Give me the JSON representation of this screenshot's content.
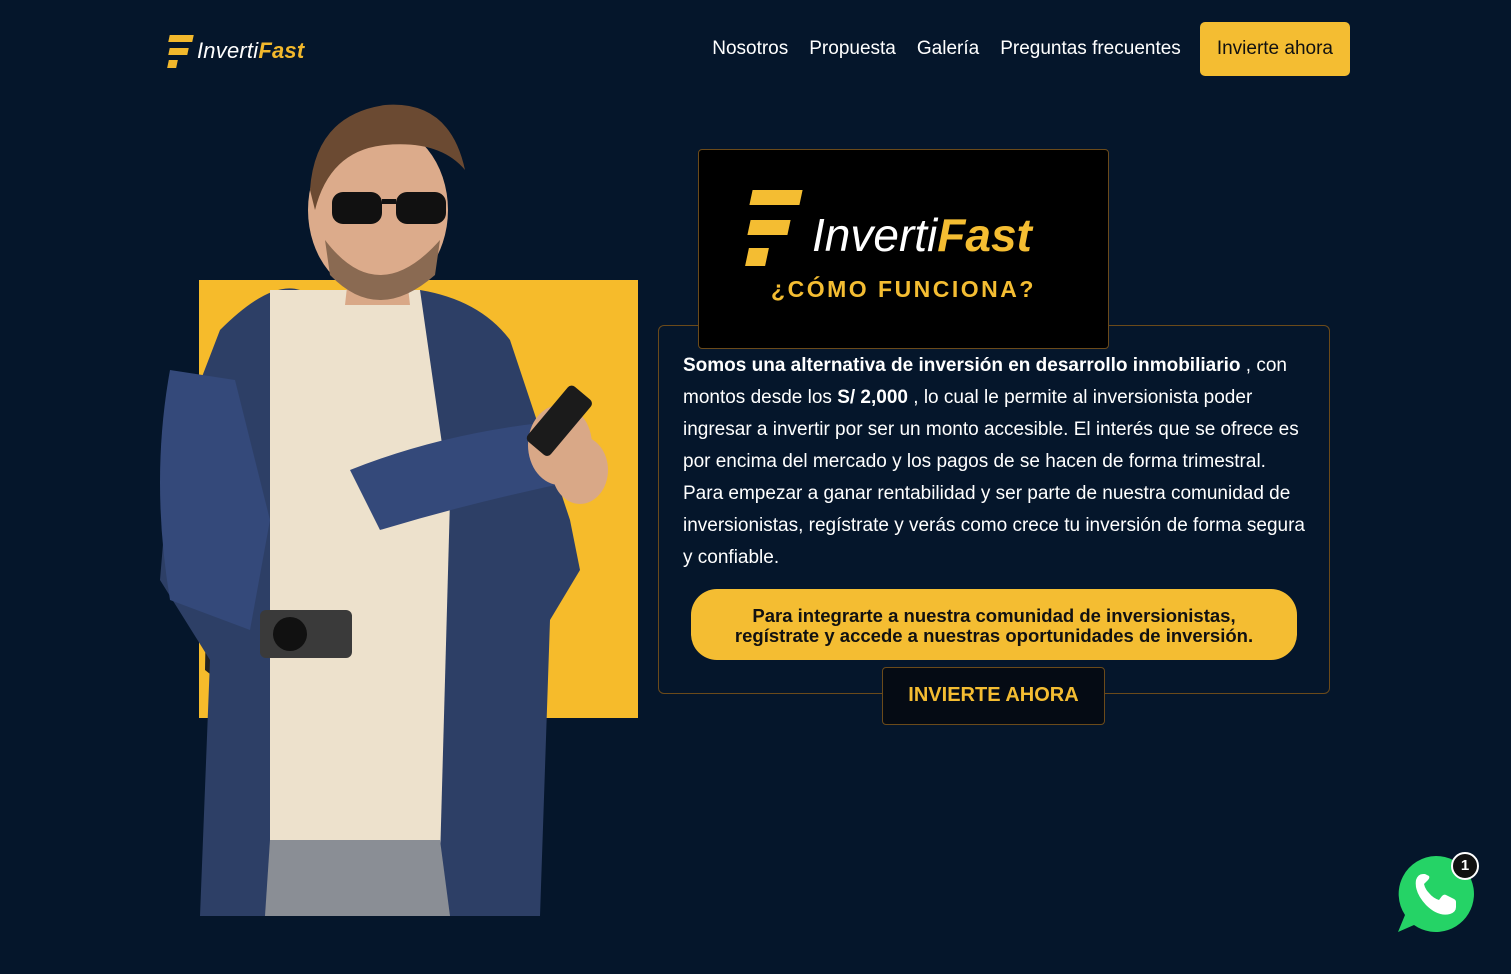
{
  "brand": {
    "name_light": "Inverti",
    "name_bold": "Fast",
    "accent": "#f4bd32",
    "background": "#05162b"
  },
  "nav": {
    "items": [
      "Nosotros",
      "Propuesta",
      "Galería",
      "Preguntas frecuentes"
    ],
    "cta": "Invierte ahora"
  },
  "hero": {
    "heading": "¿CÓMO FUNCIONA?",
    "intro_bold": "Somos una alternativa de inversión en desarrollo inmobiliario",
    "intro_rest_1": " , con montos desde los ",
    "amount": "S/ 2,000",
    "intro_rest_2": " , lo cual le permite al inversionista poder ingresar a invertir por ser un monto accesible. El interés que se ofrece es por encima del mercado y los pagos de se hacen de forma trimestral.  Para empezar a ganar rentabilidad y ser parte de nuestra comunidad de inversionistas, regístrate y verás como crece tu inversión de forma segura y confiable.",
    "join_text_1": "Para integrarte a nuestra comunidad de inversionistas,",
    "join_text_2": "regístrate y accede a nuestras oportunidades de inversión.",
    "button": "INVIERTE AHORA"
  },
  "whatsapp": {
    "icon": "whatsapp-icon",
    "badge": "1",
    "color": "#25d366"
  }
}
